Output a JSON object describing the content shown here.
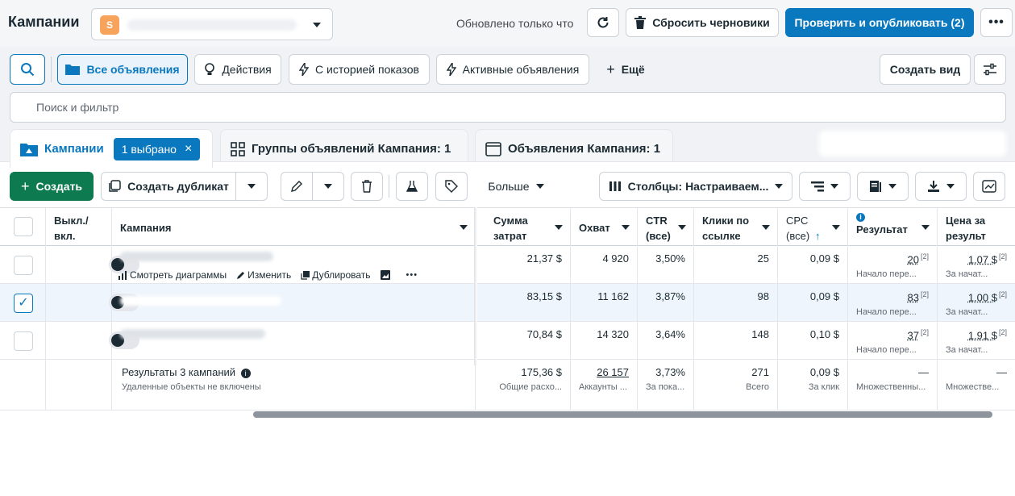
{
  "header": {
    "title": "Кампании",
    "account_initial": "S",
    "updated": "Обновлено только что",
    "discard_label": "Сбросить черновики",
    "publish_label": "Проверить и опубликовать (2)"
  },
  "filters": {
    "tabs": [
      "Все объявления",
      "Действия",
      "С историей показов",
      "Активные объявления"
    ],
    "more_label": "Ещё",
    "create_view_label": "Создать вид",
    "search_placeholder": "Поиск и фильтр"
  },
  "level_tabs": {
    "campaigns": "Кампании",
    "selected_badge": "1 выбрано",
    "adsets": "Группы объявлений Кампания: 1",
    "ads": "Объявления Кампания: 1"
  },
  "toolbar": {
    "create_label": "Создать",
    "duplicate_label": "Создать дубликат",
    "more_label": "Больше",
    "columns_label": "Столбцы: Настраиваем..."
  },
  "table": {
    "headers": {
      "toggle": "Выкл./ вкл.",
      "campaign": "Кампания",
      "spend": "Сумма затрат",
      "reach": "Охват",
      "ctr": "CTR (все)",
      "clicks": "Клики по ссылке",
      "cpc": "CPC (все)",
      "results": "Результат",
      "cost": "Цена за результ"
    },
    "row_actions": [
      "Смотреть диаграммы",
      "Изменить",
      "Дублировать"
    ],
    "rows": [
      {
        "checked": false,
        "spend": "21,37 $",
        "reach": "4 920",
        "ctr": "3,50%",
        "clicks": "25",
        "cpc": "0,09 $",
        "results": "20",
        "results_sub": "Начало пере...",
        "cost": "1,07 $",
        "cost_sub": "За начат..."
      },
      {
        "checked": true,
        "spend": "83,15 $",
        "reach": "11 162",
        "ctr": "3,87%",
        "clicks": "98",
        "cpc": "0,09 $",
        "results": "83",
        "results_sub": "Начало пере...",
        "cost": "1,00 $",
        "cost_sub": "За начат..."
      },
      {
        "checked": false,
        "spend": "70,84 $",
        "reach": "14 320",
        "ctr": "3,64%",
        "clicks": "148",
        "cpc": "0,10 $",
        "results": "37",
        "results_sub": "Начало пере...",
        "cost": "1,91 $",
        "cost_sub": "За начат..."
      }
    ],
    "footnote_mark": "[2]",
    "totals": {
      "title": "Результаты 3 кампаний",
      "note": "Удаленные объекты не включены",
      "spend": "175,36 $",
      "spend_sub": "Общие расхо...",
      "reach": "26 157",
      "reach_sub": "Аккаунты ...",
      "ctr": "3,73%",
      "ctr_sub": "За пока...",
      "clicks": "271",
      "clicks_sub": "Всего",
      "cpc": "0,09 $",
      "cpc_sub": "За клик",
      "results": "—",
      "results_sub": "Множественны...",
      "cost": "—",
      "cost_sub": "Множестве..."
    }
  }
}
